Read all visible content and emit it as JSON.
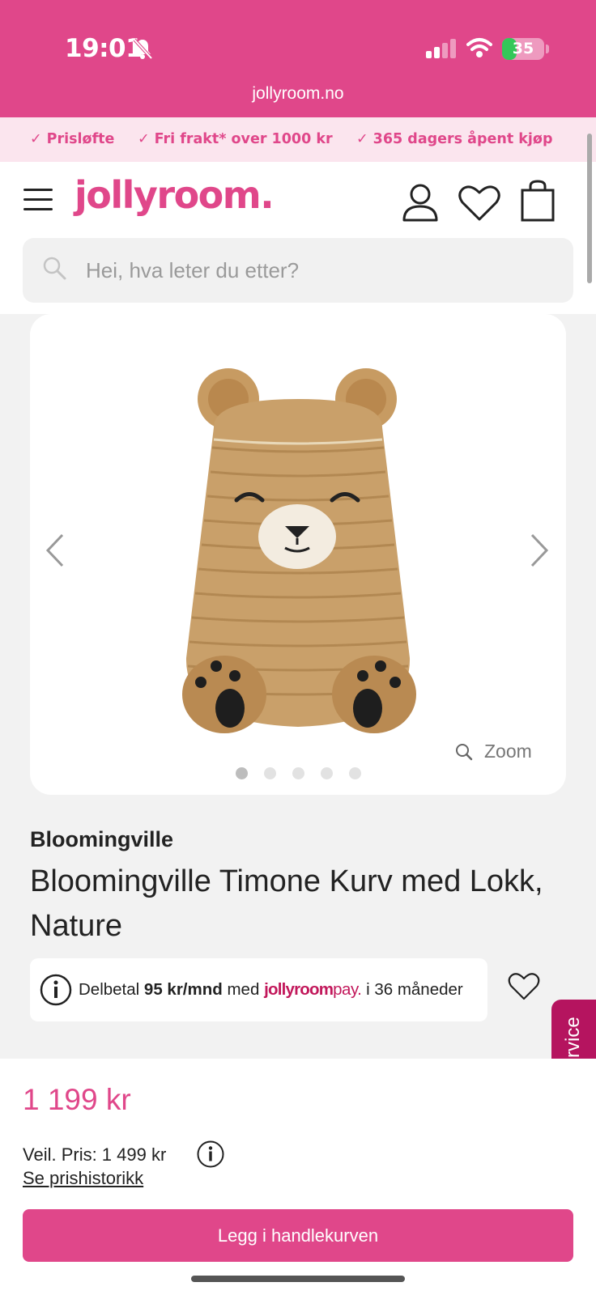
{
  "status_bar": {
    "time": "19:01",
    "battery": "35",
    "battery_level": 0.35
  },
  "browser": {
    "url": "jollyroom.no"
  },
  "usp": [
    "Prisløfte",
    "Fri frakt* over 1000 kr",
    "365 dagers åpent kjøp"
  ],
  "header": {
    "logo": "jollyroom.",
    "search_placeholder": "Hei, hva leter du etter?"
  },
  "gallery": {
    "zoom_label": "Zoom",
    "slide_count": 5,
    "active_slide": 1
  },
  "product": {
    "brand": "Bloomingville",
    "title": "Bloomingville Timone Kurv med Lokk, Nature"
  },
  "payment": {
    "prefix": "Delbetal",
    "amount": "95 kr/mnd",
    "mid": "med",
    "logo_main": "jollyroom",
    "logo_pay": "pay.",
    "suffix": "i 36 måneder"
  },
  "side_tab": {
    "label": "Kundeservice"
  },
  "pricing": {
    "price": "1 199 kr",
    "recommended": "Veil. Pris: 1 499 kr",
    "history_link": "Se prishistorikk",
    "add_to_cart": "Legg i handlekurven"
  },
  "colors": {
    "brand": "#e0478a",
    "dark_brand": "#b5145f",
    "usp_bg": "#fbe5ee"
  }
}
